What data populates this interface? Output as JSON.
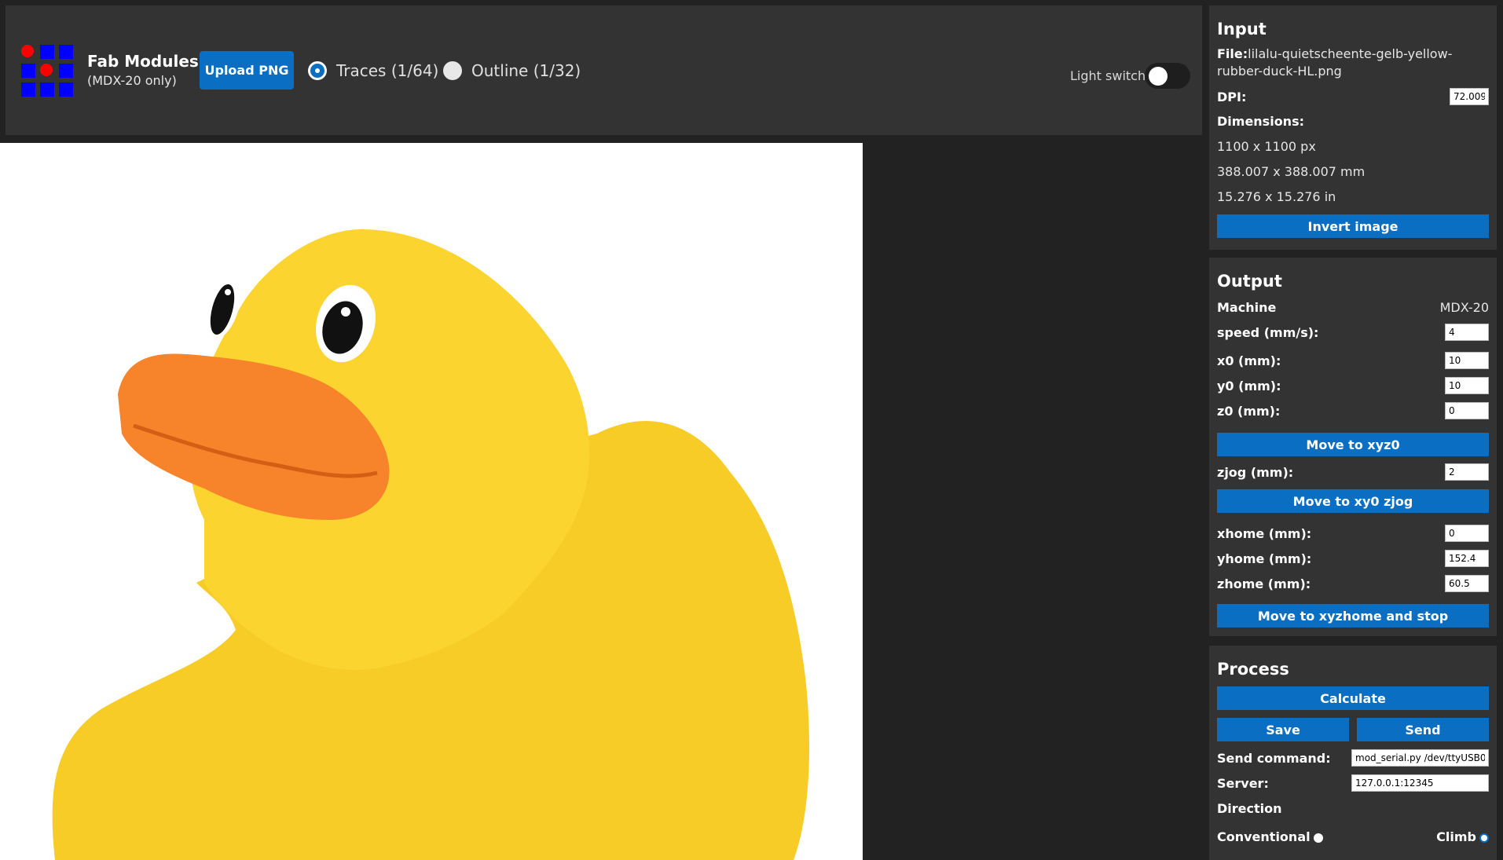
{
  "app": {
    "title": "Fab Modules",
    "subtitle": "(MDX-20 only)",
    "logo_colors": [
      "#ff0000",
      "#0000ff"
    ]
  },
  "toolbar": {
    "upload_label": "Upload PNG",
    "mode_options": [
      {
        "label": "Traces (1/64)",
        "selected": true
      },
      {
        "label": "Outline (1/32)",
        "selected": false
      }
    ],
    "light_switch_label": "Light switch",
    "light_switch_on": false
  },
  "image": {
    "description_icon": "rubber-duck-image"
  },
  "input": {
    "title": "Input",
    "file_label": "File:",
    "file_name": "lilalu-quietscheente-gelb-yellow-rubber-duck-HL.png",
    "dpi_label": "DPI:",
    "dpi_value": "72.009",
    "dimensions_label": "Dimensions:",
    "dim_px": "1100 x 1100 px",
    "dim_mm": "388.007 x 388.007 mm",
    "dim_in": "15.276 x 15.276 in",
    "invert_label": "Invert image"
  },
  "output": {
    "title": "Output",
    "machine_label": "Machine",
    "machine_value": "MDX-20",
    "speed_label": "speed (mm/s):",
    "speed_value": "4",
    "x0_label": "x0 (mm):",
    "x0_value": "10",
    "y0_label": "y0 (mm):",
    "y0_value": "10",
    "z0_label": "z0 (mm):",
    "z0_value": "0",
    "move_xyz0_label": "Move to xyz0",
    "zjog_label": "zjog (mm):",
    "zjog_value": "2",
    "move_xy0_zjog_label": "Move to xy0 zjog",
    "xhome_label": "xhome (mm):",
    "xhome_value": "0",
    "yhome_label": "yhome (mm):",
    "yhome_value": "152.4",
    "zhome_label": "zhome (mm):",
    "zhome_value": "60.5",
    "move_home_label": "Move to xyzhome and stop"
  },
  "process": {
    "title": "Process",
    "calculate_label": "Calculate",
    "save_label": "Save",
    "send_label": "Send",
    "send_command_label": "Send command:",
    "send_command_value": "mod_serial.py /dev/ttyUSB0",
    "server_label": "Server:",
    "server_value": "127.0.0.1:12345",
    "direction_label": "Direction",
    "conventional_label": "Conventional",
    "conventional_selected": false,
    "climb_label": "Climb",
    "climb_selected": true
  }
}
